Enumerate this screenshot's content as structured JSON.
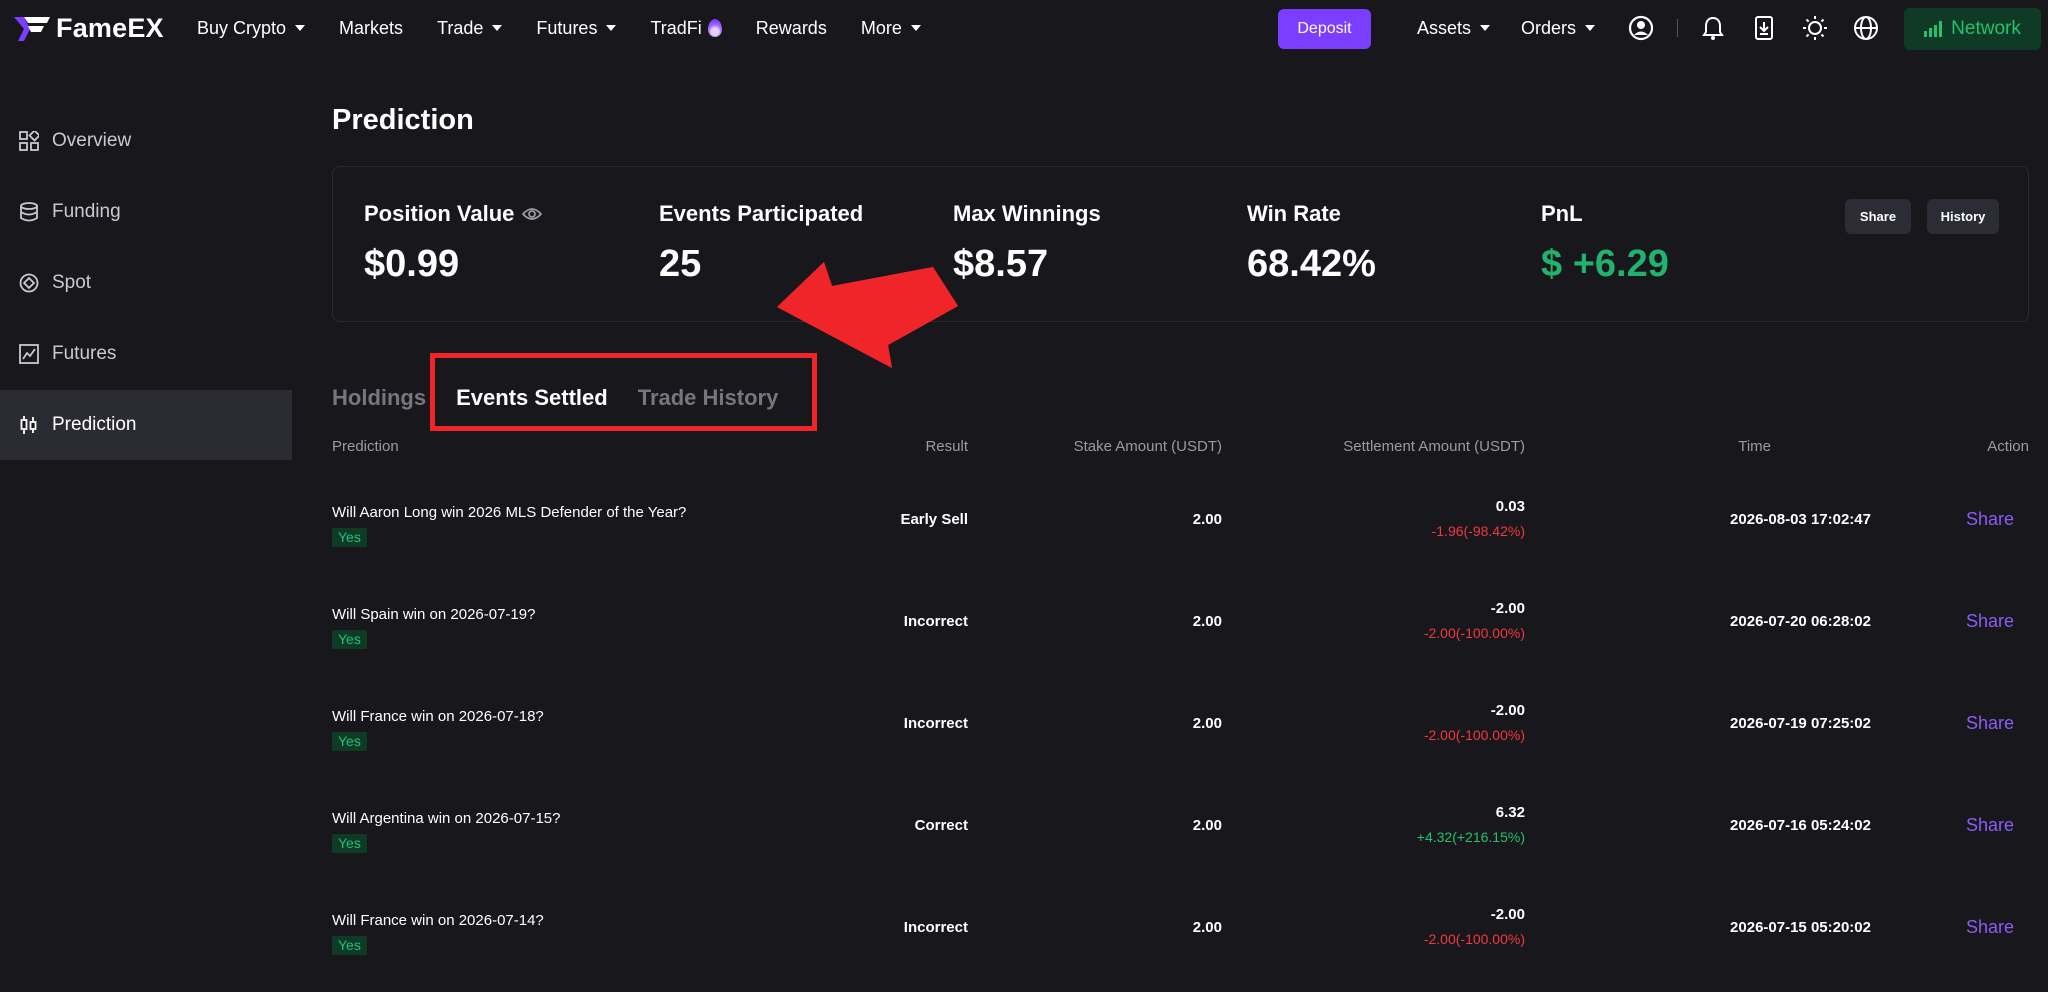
{
  "brand": {
    "name": "FameEX"
  },
  "nav": {
    "items": [
      {
        "label": "Buy Crypto",
        "caret": true
      },
      {
        "label": "Markets",
        "caret": false
      },
      {
        "label": "Trade",
        "caret": true
      },
      {
        "label": "Futures",
        "caret": true
      },
      {
        "label": "TradFi",
        "caret": false,
        "fire": true
      },
      {
        "label": "Rewards",
        "caret": false
      },
      {
        "label": "More",
        "caret": true
      }
    ],
    "deposit": "Deposit",
    "assets": "Assets",
    "orders": "Orders",
    "network": "Network"
  },
  "sidebar": {
    "items": [
      {
        "label": "Overview",
        "icon": "grid-icon"
      },
      {
        "label": "Funding",
        "icon": "coins-icon"
      },
      {
        "label": "Spot",
        "icon": "spot-icon"
      },
      {
        "label": "Futures",
        "icon": "futures-chart-icon"
      },
      {
        "label": "Prediction",
        "icon": "candlestick-icon",
        "active": true
      }
    ]
  },
  "page": {
    "title": "Prediction"
  },
  "summary": {
    "position_value_label": "Position Value",
    "position_value": "$0.99",
    "events_label": "Events Participated",
    "events_value": "25",
    "max_label": "Max Winnings",
    "max_value": "$8.57",
    "winrate_label": "Win Rate",
    "winrate_value": "68.42%",
    "pnl_label": "PnL",
    "pnl_value": "$ +6.29",
    "share": "Share",
    "history": "History"
  },
  "tabs": [
    {
      "label": "Holdings",
      "active": false
    },
    {
      "label": "Events Settled",
      "active": true
    },
    {
      "label": "Trade History",
      "active": false
    }
  ],
  "table": {
    "headers": {
      "prediction": "Prediction",
      "result": "Result",
      "stake": "Stake Amount (USDT)",
      "settlement": "Settlement Amount (USDT)",
      "time": "Time",
      "action": "Action"
    },
    "rows": [
      {
        "question": "Will Aaron Long win 2026 MLS Defender of the Year?",
        "side": "Yes",
        "result": "Early Sell",
        "stake": "2.00",
        "settlement": "0.03",
        "change": "-1.96(-98.42%)",
        "change_sign": "neg",
        "time": "2026-08-03 17:02:47",
        "action": "Share"
      },
      {
        "question": "Will Spain win on 2026-07-19?",
        "side": "Yes",
        "result": "Incorrect",
        "stake": "2.00",
        "settlement": "-2.00",
        "change": "-2.00(-100.00%)",
        "change_sign": "neg",
        "time": "2026-07-20 06:28:02",
        "action": "Share"
      },
      {
        "question": "Will France win on 2026-07-18?",
        "side": "Yes",
        "result": "Incorrect",
        "stake": "2.00",
        "settlement": "-2.00",
        "change": "-2.00(-100.00%)",
        "change_sign": "neg",
        "time": "2026-07-19 07:25:02",
        "action": "Share"
      },
      {
        "question": "Will Argentina win on 2026-07-15?",
        "side": "Yes",
        "result": "Correct",
        "stake": "2.00",
        "settlement": "6.32",
        "change": "+4.32(+216.15%)",
        "change_sign": "pos",
        "time": "2026-07-16 05:24:02",
        "action": "Share"
      },
      {
        "question": "Will France win on 2026-07-14?",
        "side": "Yes",
        "result": "Incorrect",
        "stake": "2.00",
        "settlement": "-2.00",
        "change": "-2.00(-100.00%)",
        "change_sign": "neg",
        "time": "2026-07-15 05:20:02",
        "action": "Share"
      }
    ]
  },
  "colors": {
    "accent": "#7b3dff",
    "positive": "#23c16e",
    "negative": "#f03a3f",
    "annotation": "#f0252a"
  }
}
